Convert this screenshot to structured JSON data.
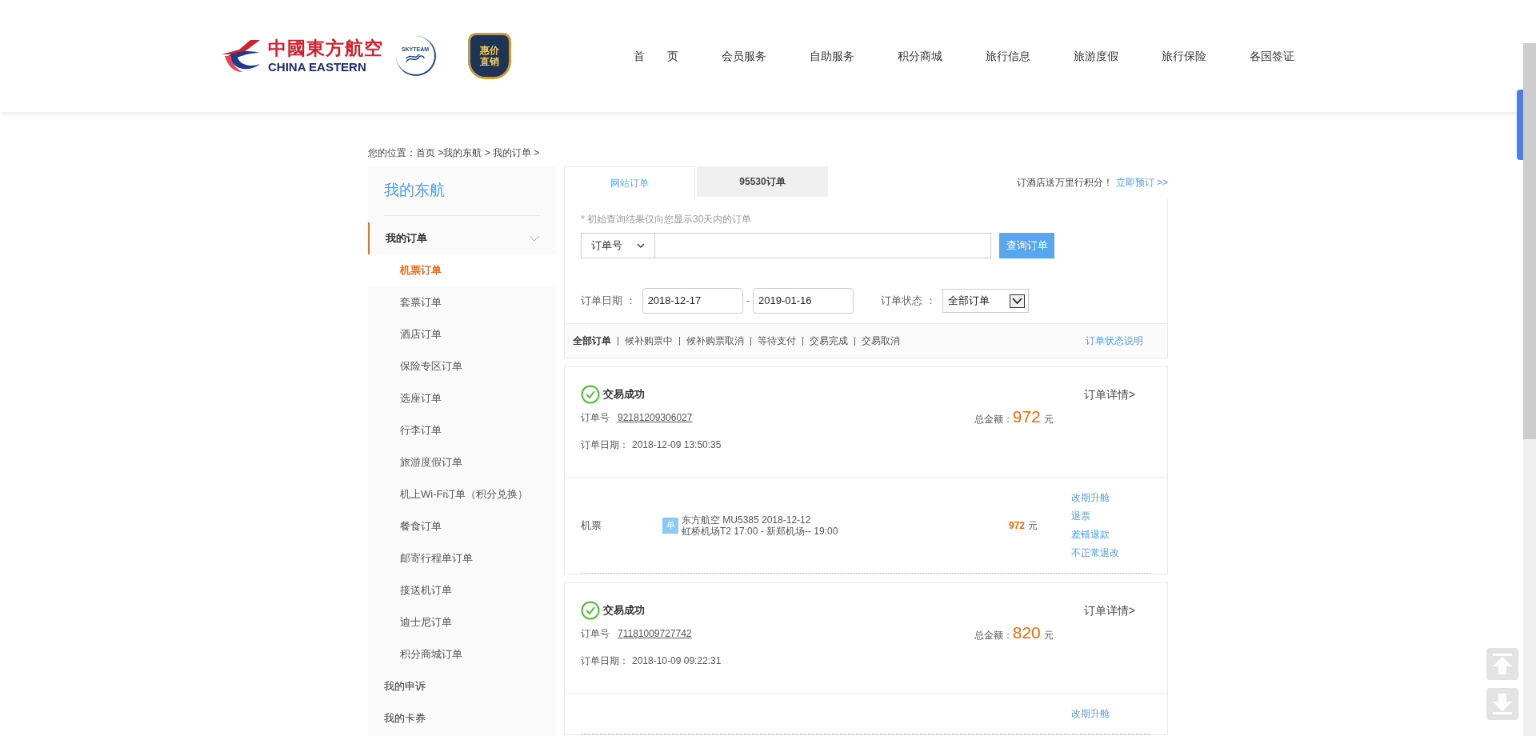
{
  "header": {
    "logo": {
      "name_cn": "中國東方航空",
      "name_en": "CHINA EASTERN"
    },
    "alliance": {
      "label": "SKYTEAM"
    },
    "badge": {
      "line1": "惠价",
      "line2": "直销"
    },
    "nav": [
      {
        "label": "首　　页"
      },
      {
        "label": "会员服务"
      },
      {
        "label": "自助服务"
      },
      {
        "label": "积分商城"
      },
      {
        "label": "旅行信息"
      },
      {
        "label": "旅游度假"
      },
      {
        "label": "旅行保险"
      },
      {
        "label": "各国签证"
      }
    ]
  },
  "breadcrumb": "您的位置：首页 >我的东航 > 我的订单 >",
  "sidebar": {
    "title": "我的东航",
    "items": [
      {
        "label": "我的订单",
        "expanded": true,
        "children": [
          {
            "label": "机票订单",
            "selected": true
          },
          {
            "label": "套票订单",
            "selected": false
          },
          {
            "label": "酒店订单",
            "selected": false
          },
          {
            "label": "保险专区订单",
            "selected": false
          },
          {
            "label": "选座订单",
            "selected": false
          },
          {
            "label": "行李订单",
            "selected": false
          },
          {
            "label": "旅游度假订单",
            "selected": false
          },
          {
            "label": "机上Wi-Fi订单（积分兑换）",
            "selected": false
          },
          {
            "label": "餐食订单",
            "selected": false
          },
          {
            "label": "邮寄行程单订单",
            "selected": false
          },
          {
            "label": "接送机订单",
            "selected": false
          },
          {
            "label": "迪士尼订单",
            "selected": false
          },
          {
            "label": "积分商城订单",
            "selected": false
          }
        ]
      },
      {
        "label": "我的申诉"
      },
      {
        "label": "我的卡券"
      }
    ]
  },
  "tabs": [
    {
      "label": "网站订单",
      "selected": true
    },
    {
      "label": "95530订单",
      "selected": false
    }
  ],
  "promo": {
    "text": "订酒店送万里行积分！",
    "link": "立即预订 >>"
  },
  "search": {
    "note": "* 初始查询结果仅向您显示30天内的订单",
    "type_select": "订单号",
    "button": "查询订单",
    "date_label": "订单日期 ：",
    "date_from": "2018-12-17",
    "date_sep": "-",
    "date_to": "2019-01-16",
    "status_label": "订单状态 ：",
    "status_value": "全部订单"
  },
  "status_filters": [
    {
      "label": "全部订单",
      "selected": true
    },
    {
      "label": "候补购票中",
      "selected": false
    },
    {
      "label": "候补购票取消",
      "selected": false
    },
    {
      "label": "等待支付",
      "selected": false
    },
    {
      "label": "交易完成",
      "selected": false
    },
    {
      "label": "交易取消",
      "selected": false
    }
  ],
  "status_help": "订单状态说明",
  "orders": [
    {
      "status": "交易成功",
      "order_no_label": "订单号",
      "order_no": "92181209306027",
      "date_label": "订单日期：",
      "date": "2018-12-09 13:50:35",
      "total_label": "总金额：",
      "total": "972",
      "currency": "元",
      "detail_link": "订单详情>",
      "items": [
        {
          "type": "机票",
          "badge": "单",
          "line1": "东方航空 MU5385 2018-12-12",
          "line2": "虹桥机场T2 17:00 - 新郑机场-- 19:00",
          "price": "972",
          "currency": "元",
          "actions": [
            "改期升舱",
            "退票",
            "差错退款",
            "不正常退改"
          ]
        }
      ]
    },
    {
      "status": "交易成功",
      "order_no_label": "订单号",
      "order_no": "71181009727742",
      "date_label": "订单日期：",
      "date": "2018-10-09 09:22:31",
      "total_label": "总金额：",
      "total": "820",
      "currency": "元",
      "detail_link": "订单详情>",
      "items": [
        {
          "actions": [
            "改期升舱"
          ]
        }
      ]
    }
  ]
}
